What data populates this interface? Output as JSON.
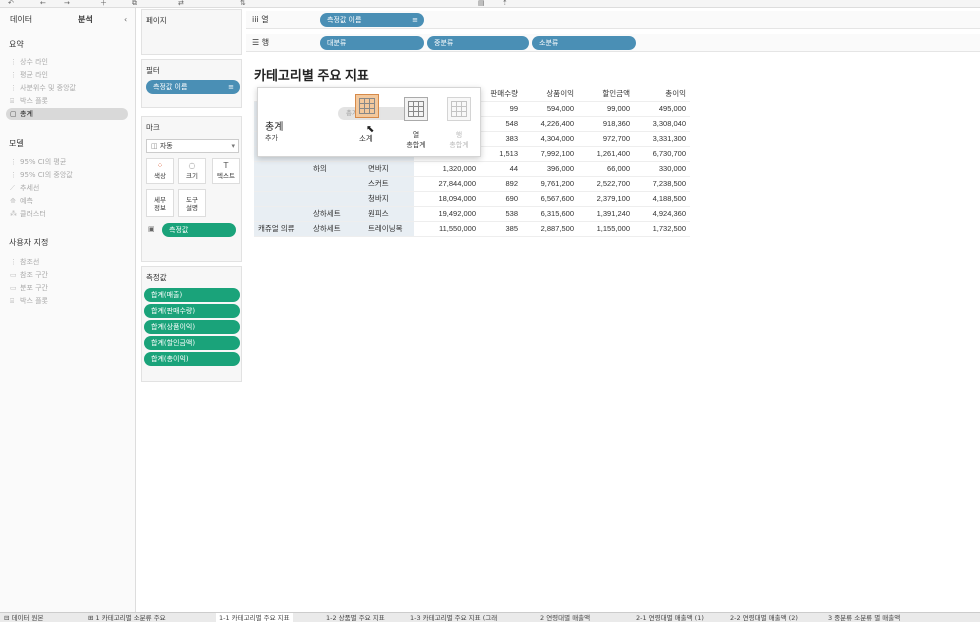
{
  "left_pane": {
    "tabs": [
      "데이터",
      "분석"
    ],
    "sections": [
      {
        "title": "요약",
        "items": [
          "상수 라인",
          "평균 라인",
          "사분위수 및 중앙값",
          "박스 플롯",
          "총계"
        ]
      },
      {
        "title": "모델",
        "items": [
          "95% CI의 평균",
          "95% CI의 중앙값",
          "추세선",
          "예측",
          "클러스터"
        ]
      },
      {
        "title": "사용자 지정",
        "items": [
          "참조선",
          "참조 구간",
          "분포 구간",
          "박스 플롯"
        ]
      }
    ],
    "active_item": "총계"
  },
  "panes": {
    "pages_title": "페이지",
    "filters_title": "필터",
    "filter_pill": "측정값 이름",
    "marks_title": "마크",
    "marks_type": "자동",
    "mark_buttons": [
      {
        "label": "색상",
        "icon": "color-icon"
      },
      {
        "label": "크기",
        "icon": "size-icon"
      },
      {
        "label": "텍스트",
        "icon": "text-icon"
      },
      {
        "label": "세부\n정보",
        "icon": "detail-icon"
      },
      {
        "label": "도구\n설명",
        "icon": "tooltip-icon"
      }
    ],
    "marks_pill": "측정값",
    "measures_title": "측정값",
    "measure_pills": [
      "합계(매출)",
      "합계(판매수량)",
      "합계(상품이익)",
      "합계(할인금액)",
      "합계(총이익)"
    ]
  },
  "shelves": {
    "columns_label": "열",
    "rows_label": "행",
    "column_pills": [
      "측정값 이름"
    ],
    "row_pills": [
      "대분류",
      "중분류",
      "소분류"
    ]
  },
  "viz": {
    "title": "카테고리별 주요 지표",
    "columns": [
      "",
      "",
      "",
      "",
      "판매수량",
      "상품이익",
      "할인금액",
      "총이익"
    ],
    "rows": [
      {
        "c1": "",
        "c2": "",
        "c3": "",
        "v": [
          "",
          "99",
          "594,000",
          "99,000",
          "495,000"
        ]
      },
      {
        "c1": "",
        "c2": "",
        "c3": "",
        "v": [
          "",
          "548",
          "4,226,400",
          "918,360",
          "3,308,040"
        ]
      },
      {
        "c1": "",
        "c2": "",
        "c3": "",
        "v": [
          "",
          "383",
          "4,304,000",
          "972,700",
          "3,331,300"
        ]
      },
      {
        "c1": "",
        "c2": "",
        "c3": "",
        "v": [
          "",
          "1,513",
          "7,992,100",
          "1,261,400",
          "6,730,700"
        ]
      },
      {
        "c1": "",
        "c2": "하의",
        "c3": "면바지",
        "v": [
          "1,320,000",
          "44",
          "396,000",
          "66,000",
          "330,000"
        ]
      },
      {
        "c1": "",
        "c2": "",
        "c3": "스커트",
        "v": [
          "27,844,000",
          "892",
          "9,761,200",
          "2,522,700",
          "7,238,500"
        ]
      },
      {
        "c1": "",
        "c2": "",
        "c3": "청바지",
        "v": [
          "18,094,000",
          "690",
          "6,567,600",
          "2,379,100",
          "4,188,500"
        ]
      },
      {
        "c1": "",
        "c2": "상하세트",
        "c3": "원피스",
        "v": [
          "19,492,000",
          "538",
          "6,315,600",
          "1,391,240",
          "4,924,360"
        ]
      },
      {
        "c1": "캐쥬얼 의류",
        "c2": "상하세트",
        "c3": "트레이닝복",
        "v": [
          "11,550,000",
          "385",
          "2,887,500",
          "1,155,000",
          "1,732,500"
        ]
      }
    ]
  },
  "popup": {
    "title": "총계",
    "subtitle": "추가",
    "drag_label": "총계",
    "options": [
      "소계",
      "열\n총합계",
      "행\n총합계"
    ]
  },
  "bottom_tabs": [
    "데이터 원본",
    "1 카테고리별 소분류 주요",
    "1-1 카테고리별 주요 지표",
    "1-2 상품별 주요 지표",
    "1-3 카테고리별 주요 지표 (그래",
    "2 연령대별 매출액",
    "2-1 연령대별 매출액 (1)",
    "2-2 연령대별 매출액 (2)",
    "3 중분류 소분류 별 매출액"
  ]
}
